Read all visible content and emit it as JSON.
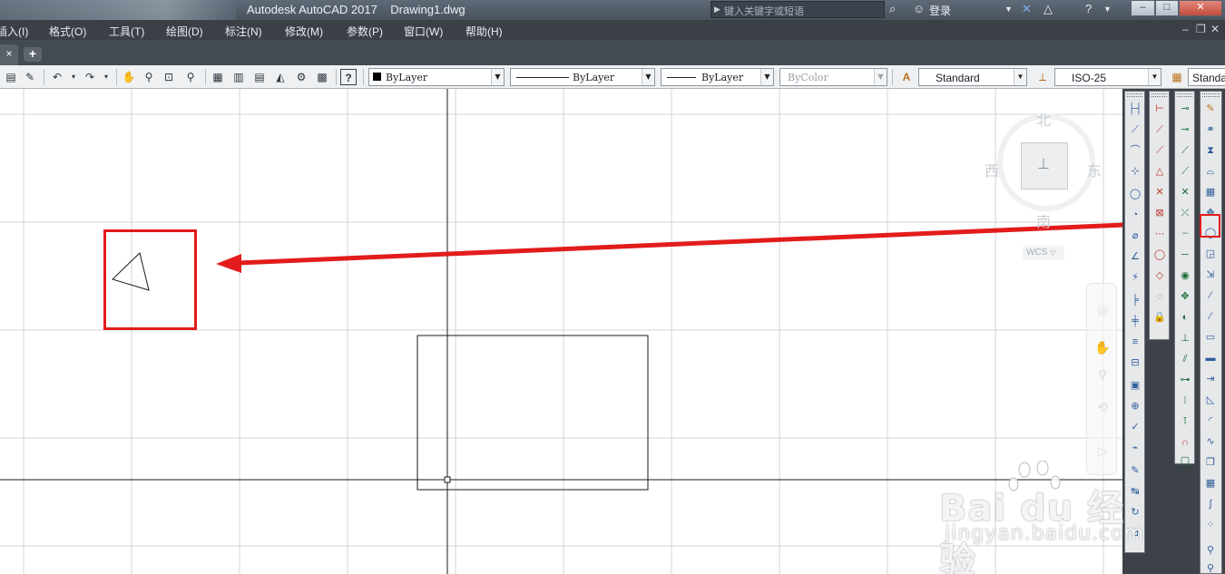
{
  "window": {
    "app_title": "Autodesk AutoCAD 2017",
    "document": "Drawing1.dwg",
    "search_placeholder": "键入关键字或短语",
    "login_label": "登录"
  },
  "menu": {
    "items": [
      "插入(I)",
      "格式(O)",
      "工具(T)",
      "绘图(D)",
      "标注(N)",
      "修改(M)",
      "参数(P)",
      "窗口(W)",
      "帮助(H)"
    ]
  },
  "filetabs": {
    "new_tab": "+"
  },
  "properties": {
    "color": "ByLayer",
    "linetype": "ByLayer",
    "lineweight": "ByLayer",
    "plotstyle": "ByColor",
    "text_style": "Standard",
    "dim_style": "ISO-25",
    "table_style": "Standa"
  },
  "viewcube": {
    "north": "北",
    "south": "南",
    "east": "东",
    "west": "西",
    "ucs": "WCS"
  },
  "annotation": {
    "highlight_color": "#e21c1c"
  },
  "watermark": {
    "brand": "Bai du 经验",
    "url": "jingyan.baidu.com"
  },
  "icons": {
    "toolbar": [
      "new-icon",
      "match-properties-icon",
      "undo-icon",
      "redo-icon",
      "pan-icon",
      "zoom-realtime-icon",
      "zoom-window-icon",
      "zoom-previous-icon",
      "properties-icon",
      "design-center-icon",
      "tool-palettes-icon",
      "sheet-set-icon",
      "markup-icon",
      "calculator-icon",
      "help-icon",
      "text-style-icon",
      "dim-style-icon",
      "table-style-icon"
    ]
  }
}
